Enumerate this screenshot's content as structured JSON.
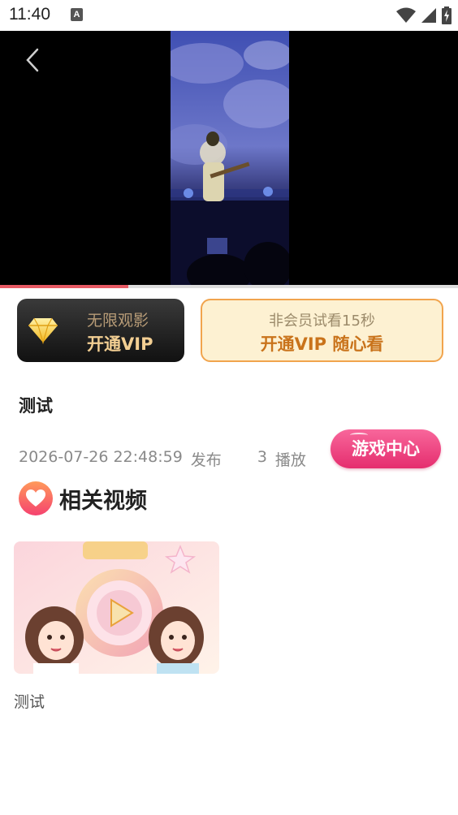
{
  "status_bar": {
    "time": "11:40",
    "notification_badge": "A",
    "icons": [
      "wifi-icon",
      "signal-icon",
      "battery-charging-icon"
    ]
  },
  "player": {
    "back_icon": "chevron-left-icon",
    "progress": 0.28
  },
  "vip_left": {
    "icon": "diamond-icon",
    "subtitle": "无限观影",
    "label": "开通VIP"
  },
  "vip_right": {
    "subtitle": "非会员试看15秒",
    "label": "开通VIP 随心看"
  },
  "video": {
    "title": "测试",
    "date": "2026-07-26 22:48:59",
    "publish_label": "发布",
    "play_count": "3",
    "play_label": "播放"
  },
  "game_center": {
    "label": "游戏中心"
  },
  "related": {
    "icon": "heart-icon",
    "title": "相关视频",
    "items": [
      {
        "title": "测试",
        "thumbnail": "play-icon"
      }
    ]
  },
  "colors": {
    "progress": "#e85a64",
    "vip_gold": "#f3cf93",
    "vip_orange": "#c9731b",
    "game_pink": "#e52d6e"
  }
}
